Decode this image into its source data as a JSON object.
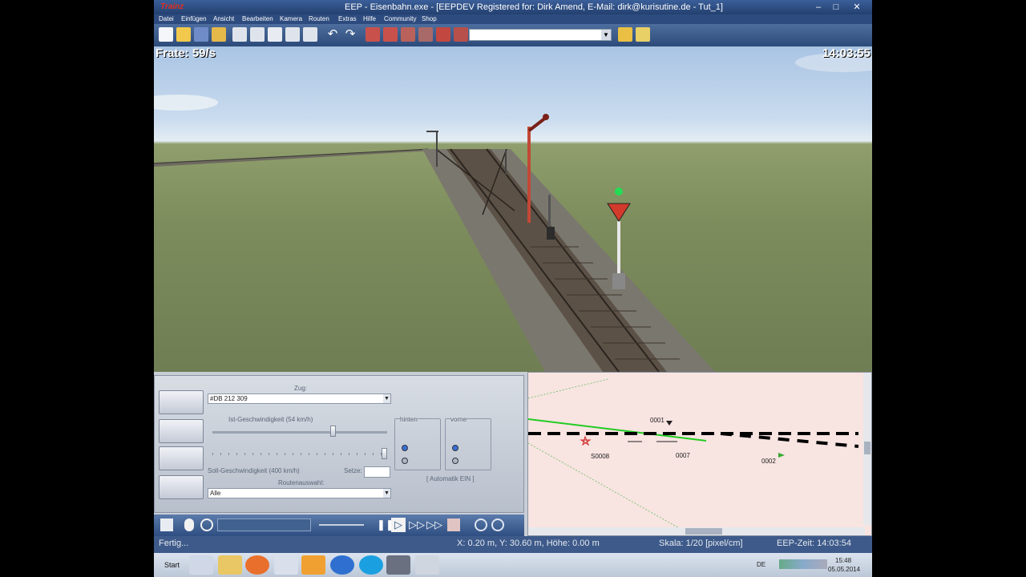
{
  "window": {
    "logo": "Trainz",
    "title": "EEP - Eisenbahn.exe - [EEPDEV Registered for: Dirk Amend, E-Mail: dirk@kurisutine.de - Tut_1]",
    "minimize": "–",
    "maximize": "□",
    "close": "✕"
  },
  "menu": [
    "Datei",
    "Einfügen",
    "Ansicht",
    "Bearbeiten",
    "Kamera",
    "Routen",
    "Extras",
    "Hilfe",
    "Community",
    "Shop"
  ],
  "toolbar": {
    "combo_value": "",
    "combo_arrow": "▼"
  },
  "hud": {
    "framerate": "Frate: 59/s",
    "clock": "14:03:55"
  },
  "train_panel": {
    "zug_label": "Zug:",
    "zug_value": "#DB 212 309",
    "ist_label": "Ist-Geschwindigkeit (54 km/h)",
    "soll_label": "Soll-Geschwindigkeit (400 km/h)",
    "setze_label": "Setze:",
    "setze_value": "",
    "routen_label": "Routenauswahl:",
    "routen_value": "Alle",
    "hinten_label": "hinten",
    "vorne_label": "vorne",
    "automatik": "[ Automatik EIN ]",
    "ist_speed_fraction": 0.69
  },
  "map": {
    "labels": [
      "0001",
      "S0008",
      "0007",
      "0002"
    ]
  },
  "status": {
    "ready": "Fertig...",
    "coords": "X: 0.20 m, Y: 30.60 m, Höhe: 0.00 m",
    "scale": "Skala: 1/20 [pixel/cm]",
    "eep_time": "EEP-Zeit: 14:03:54"
  },
  "taskbar": {
    "start": "Start",
    "language": "DE",
    "time": "15:48",
    "date": "05.05.2014"
  },
  "colors": {
    "title_bar": "#2d4b7e",
    "map_bg": "#f8e4e1",
    "signal_green": "#22dd55",
    "track_green": "#22cc22"
  }
}
